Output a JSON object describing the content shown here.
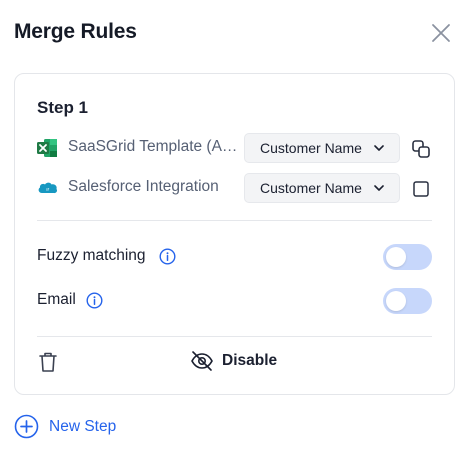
{
  "header": {
    "title": "Merge Rules"
  },
  "step": {
    "title": "Step 1",
    "sources": [
      {
        "name": "SaaSGrid Template (A…",
        "icon": "excel-icon",
        "select_value": "Customer Name",
        "action_icon": "copy-icon"
      },
      {
        "name": "Salesforce Integration",
        "icon": "salesforce-icon",
        "select_value": "Customer Name",
        "action_icon": "checkbox"
      }
    ],
    "options": [
      {
        "label": "Fuzzy matching",
        "enabled": false
      },
      {
        "label": "Email",
        "enabled": false
      }
    ],
    "disable_label": "Disable"
  },
  "new_step_label": "New Step",
  "colors": {
    "accent": "#2563eb",
    "toggle_off": "#c7d7fb",
    "excel_green": "#1f7a45",
    "salesforce_blue": "#1798c1"
  }
}
